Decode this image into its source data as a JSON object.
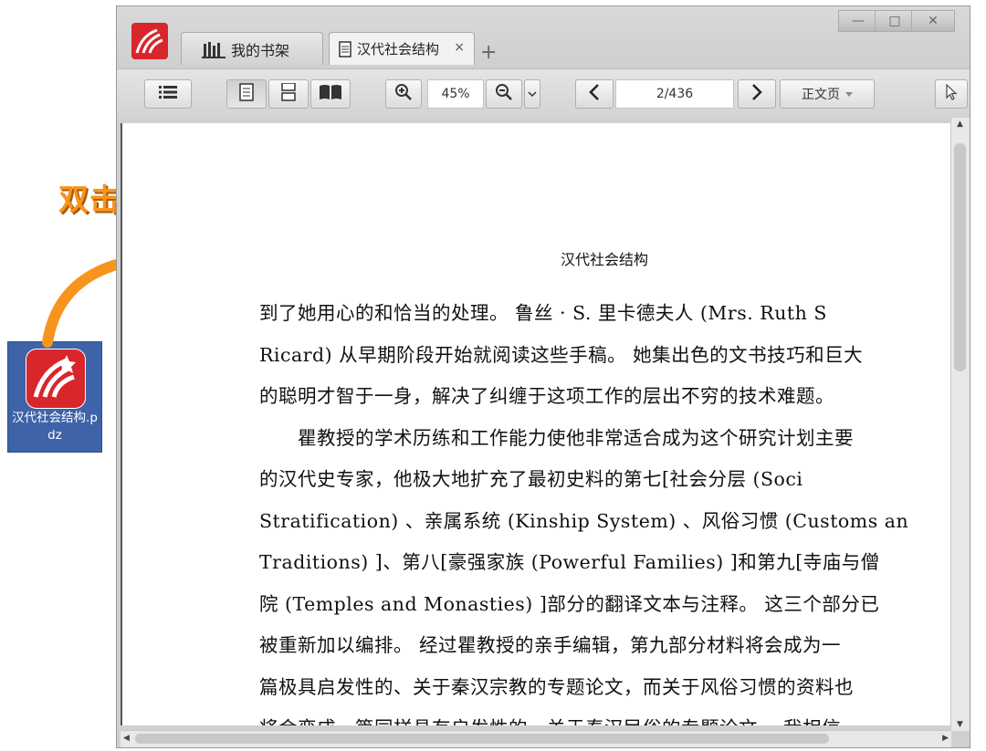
{
  "annotation": {
    "label": "双击打开"
  },
  "desktop": {
    "file_name": "汉代社会结构.pdz"
  },
  "window": {
    "tabs": [
      {
        "label": "我的书架"
      },
      {
        "label": "汉代社会结构",
        "close": "×"
      }
    ],
    "add_tab": "+",
    "controls": {
      "minimize": "—",
      "maximize": "□",
      "close": "✕"
    }
  },
  "toolbar": {
    "zoom_value": "45%",
    "page_indicator": "2/436",
    "section_label": "正文页"
  },
  "document": {
    "running_head": "汉代社会结构",
    "lines": [
      "到了她用心的和恰当的处理。 鲁丝 · S. 里卡德夫人 (Mrs. Ruth S",
      "Ricard) 从早期阶段开始就阅读这些手稿。 她集出色的文书技巧和巨大",
      "的聪明才智于一身，解决了纠缠于这项工作的层出不穷的技术难题。",
      "　　瞿教授的学术历练和工作能力使他非常适合成为这个研究计划主要",
      "的汉代史专家，他极大地扩充了最初史料的第七[社会分层 (Soci",
      "Stratification) 、亲属系统 (Kinship System) 、风俗习惯 (Customs an",
      "Traditions) ]、第八[豪强家族 (Powerful Families) ]和第九[寺庙与僧",
      "院 (Temples and Monasties) ]部分的翻译文本与注释。 这三个部分已",
      "被重新加以编排。 经过瞿教授的亲手编辑，第九部分材料将会成为一",
      "篇极具启发性的、关于秦汉宗教的专题论文，而关于风俗习惯的资料也",
      "将会变成一篇同样具有启发性的、关于秦汉民俗的专题论文。 我相信"
    ]
  },
  "colors": {
    "annotation_orange": "#f7941d",
    "brand_red": "#d8262b",
    "desktop_icon_bg": "#3f63a8"
  }
}
